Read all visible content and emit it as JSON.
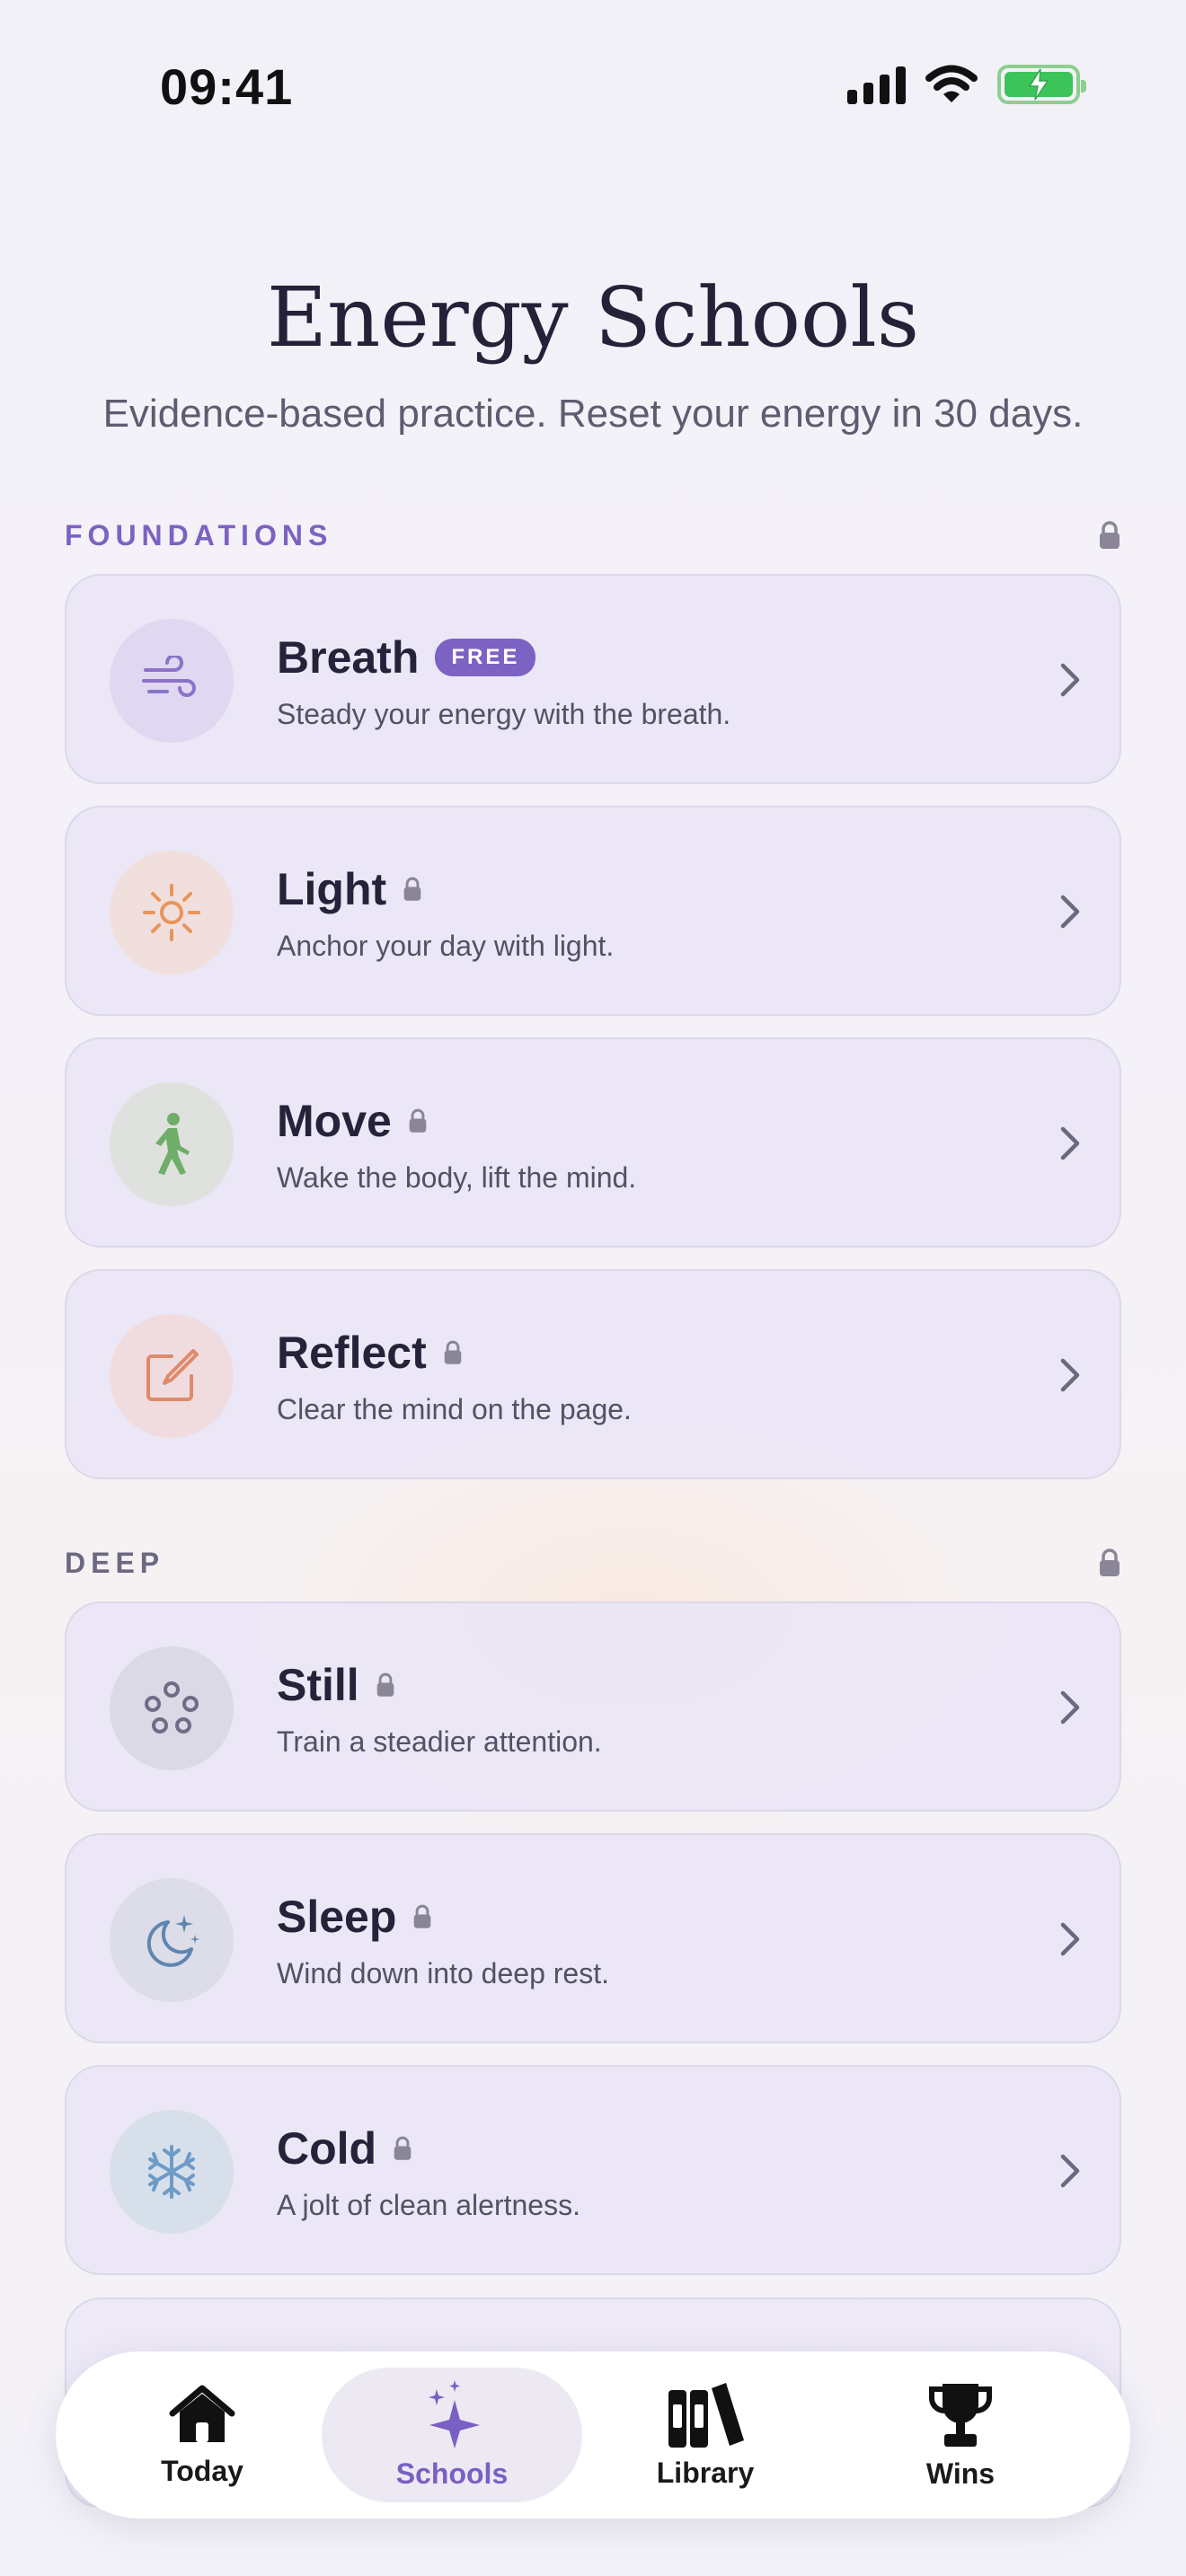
{
  "status_bar": {
    "time": "09:41"
  },
  "header": {
    "title": "Energy Schools",
    "subtitle": "Evidence-based practice. Reset your energy in 30 days."
  },
  "sections": [
    {
      "label": "FOUNDATIONS",
      "label_color": "#7c62c2",
      "locked": true,
      "items": [
        {
          "title": "Breath",
          "subtitle": "Steady your energy with the breath.",
          "badge": "FREE",
          "locked": false,
          "icon": "wind-icon",
          "icon_bg": "#e0d8f1",
          "icon_color": "#8b73c8"
        },
        {
          "title": "Light",
          "subtitle": "Anchor your day with light.",
          "locked": true,
          "icon": "sun-icon",
          "icon_bg": "#f1dfde",
          "icon_color": "#e9955a"
        },
        {
          "title": "Move",
          "subtitle": "Wake the body, lift the mind.",
          "locked": true,
          "icon": "walking-person-icon",
          "icon_bg": "#dfe1df",
          "icon_color": "#6fae68"
        },
        {
          "title": "Reflect",
          "subtitle": "Clear the mind on the page.",
          "locked": true,
          "icon": "compose-icon",
          "icon_bg": "#f0dcdf",
          "icon_color": "#df8a6a"
        }
      ]
    },
    {
      "label": "DEEP",
      "label_color": "#6b6880",
      "locked": true,
      "items": [
        {
          "title": "Still",
          "subtitle": "Train a steadier attention.",
          "locked": true,
          "icon": "circles-icon",
          "icon_bg": "#dcd9e7",
          "icon_color": "#6f6c86"
        },
        {
          "title": "Sleep",
          "subtitle": "Wind down into deep rest.",
          "locked": true,
          "icon": "moon-stars-icon",
          "icon_bg": "#dcdde8",
          "icon_color": "#5f86b0"
        },
        {
          "title": "Cold",
          "subtitle": "A jolt of clean alertness.",
          "locked": true,
          "icon": "snowflake-icon",
          "icon_bg": "#d7e0ea",
          "icon_color": "#6e9ac7"
        }
      ]
    }
  ],
  "tab_bar": {
    "tabs": [
      {
        "label": "Today",
        "icon": "house-icon",
        "active": false
      },
      {
        "label": "Schools",
        "icon": "sparkle-icon",
        "active": true
      },
      {
        "label": "Library",
        "icon": "books-icon",
        "active": false
      },
      {
        "label": "Wins",
        "icon": "trophy-icon",
        "active": false
      }
    ]
  },
  "colors": {
    "accent": "#7c62c2",
    "lock": "#8a8698"
  }
}
